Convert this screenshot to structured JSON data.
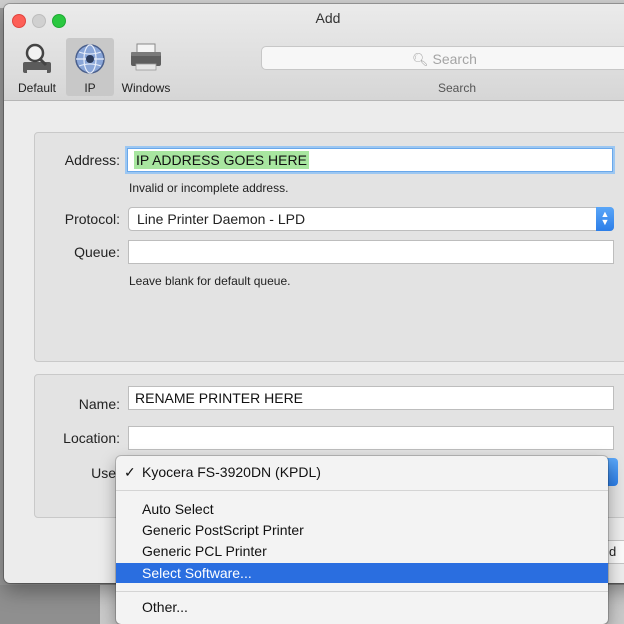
{
  "window": {
    "title": "Add"
  },
  "toolbar": {
    "tools": [
      {
        "label": "Default",
        "icon": "magnifier-printer-icon"
      },
      {
        "label": "IP",
        "icon": "globe-icon"
      },
      {
        "label": "Windows",
        "icon": "printer-icon"
      }
    ],
    "search_placeholder": "Search",
    "search_caption": "Search"
  },
  "form": {
    "address_label": "Address:",
    "address_value": "IP ADDRESS GOES HERE",
    "address_help": "Invalid or incomplete address.",
    "protocol_label": "Protocol:",
    "protocol_value": "Line Printer Daemon - LPD",
    "queue_label": "Queue:",
    "queue_value": "",
    "queue_help": "Leave blank for default queue.",
    "name_label": "Name:",
    "name_value": "RENAME PRINTER HERE",
    "location_label": "Location:",
    "location_value": "",
    "use_label": "Use"
  },
  "use_menu": {
    "selected": "Kyocera FS-3920DN (KPDL)",
    "check": "✓",
    "items": [
      "Auto Select",
      "Generic PostScript Printer",
      "Generic PCL Printer",
      "Select Software..."
    ],
    "highlighted": "Select Software...",
    "other": "Other..."
  },
  "colors": {
    "accent": "#2a6ee0",
    "address_highlight": "#a8e6a0"
  }
}
